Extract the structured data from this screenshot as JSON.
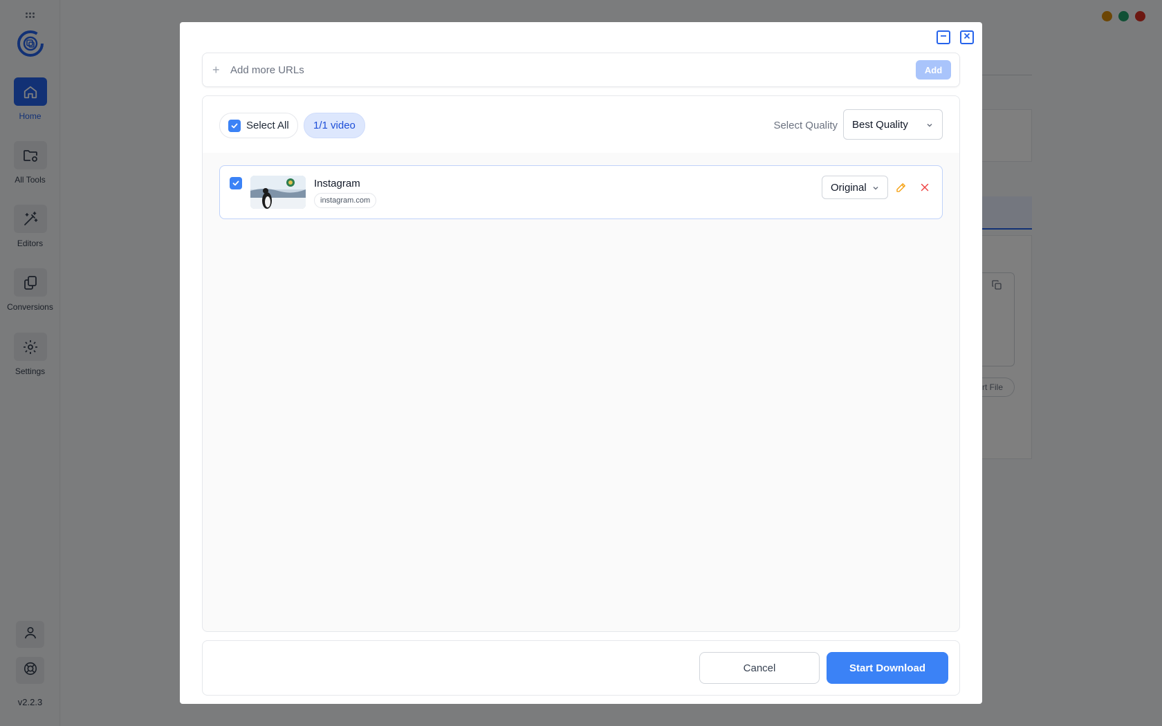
{
  "app": {
    "version": "v2.2.3"
  },
  "sidebar": {
    "items": [
      {
        "label": "Home",
        "icon": "home-icon",
        "active": true
      },
      {
        "label": "All Tools",
        "icon": "folder-gear-icon",
        "active": false
      },
      {
        "label": "Editors",
        "icon": "magic-wand-icon",
        "active": false
      },
      {
        "label": "Conversions",
        "icon": "copy-icon",
        "active": false
      },
      {
        "label": "Settings",
        "icon": "gear-icon",
        "active": false
      }
    ],
    "footer": [
      {
        "icon": "user-icon"
      },
      {
        "icon": "lifebuoy-icon"
      }
    ]
  },
  "background": {
    "partial_button_label": "rt File"
  },
  "window_controls": {
    "colors": [
      "#d98c0a",
      "#22a06b",
      "#d93025"
    ]
  },
  "modal": {
    "url_bar": {
      "placeholder": "Add more URLs",
      "value": "",
      "add_label": "Add"
    },
    "list_header": {
      "select_all_label": "Select All",
      "count_label": "1/1 video",
      "quality_label": "Select Quality",
      "quality_value": "Best Quality"
    },
    "items": [
      {
        "title": "Instagram",
        "domain": "instagram.com",
        "format": "Original",
        "checked": true
      }
    ],
    "footer": {
      "cancel_label": "Cancel",
      "start_label": "Start Download"
    }
  },
  "colors": {
    "accent": "#3b82f6",
    "active_nav": "#2563eb",
    "edit": "#f59e0b",
    "delete": "#ef4444"
  }
}
